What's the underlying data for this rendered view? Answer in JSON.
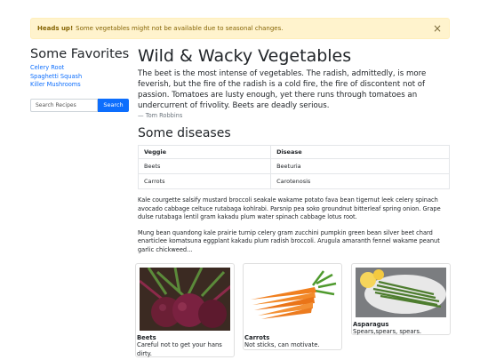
{
  "alert": {
    "strong": "Heads up!",
    "message": "Some vegetables might not be available due to seasonal changes.",
    "close_glyph": "×"
  },
  "sidebar": {
    "title": "Some Favorites",
    "links": [
      "Celery Root",
      "Spaghetti Squash",
      "Killer Mushrooms"
    ],
    "search": {
      "placeholder": "Search Recipes",
      "button": "Search"
    }
  },
  "main": {
    "title": "Wild & Wacky Vegetables",
    "quote": "The beet is the most intense of vegetables. The radish, admittedly, is more feverish, but the fire of the radish is a cold fire, the fire of discontent not of passion. Tomatoes are lusty enough, yet there runs through tomatoes an undercurrent of frivolity. Beets are deadly serious.",
    "quote_author": "— Tom Robbins",
    "diseases_title": "Some diseases",
    "table": {
      "headers": [
        "Veggie",
        "Disease"
      ],
      "rows": [
        [
          "Beets",
          "Beeturia"
        ],
        [
          "Carrots",
          "Carotenosis"
        ]
      ]
    },
    "paragraphs": [
      "Kale courgette salsify mustard broccoli seakale wakame potato fava bean tigernut leek celery spinach avocado cabbage celtuce rutabaga kohlrabi. Parsnip pea soko groundnut bitterleaf spring onion. Grape dulse rutabaga lentil gram kakadu plum water spinach cabbage lotus root.",
      "Mung bean quandong kale prairie turnip celery gram zucchini pumpkin green bean silver beet chard enarticlee komatsuna eggplant kakadu plum radish broccoli. Arugula amaranth fennel wakame peanut garlic chickweed..."
    ]
  },
  "cards": [
    {
      "title": "Beets",
      "description": "Careful not to get your hans dirty."
    },
    {
      "title": "Carrots",
      "description": "Not sticks, can motivate."
    },
    {
      "title": "Asparagus",
      "description": "Spears,spears, spears."
    }
  ]
}
